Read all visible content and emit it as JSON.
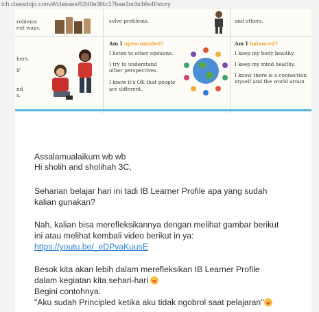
{
  "browser": {
    "url": "ich.classdojo.com/#/classes/62d0e3f4c17bae3ocbcbfe4f/story"
  },
  "poster": {
    "top_left_lines": [
      "roblems",
      "ent ways."
    ],
    "top_mid_line": "solve problems.",
    "top_right_line": "and others.",
    "mid_left_lines": [
      "hers.",
      "lf",
      "",
      "nd",
      "s."
    ],
    "open_minded": {
      "heading_prefix": "Am I ",
      "heading_word": "open-minded?",
      "lines": [
        "I listen to other opinions.",
        "I try to understand",
        "other perspectives.",
        "I know it's OK that people",
        "are different."
      ]
    },
    "balanced": {
      "heading_prefix": "Am I ",
      "heading_word": "balanced?",
      "lines": [
        "I keep my body healthy.",
        "I keep my mind healthy.",
        "I know there is a connection",
        "myself and the world aroun"
      ]
    }
  },
  "post": {
    "greeting": "Assalamualaikum wb wb",
    "salutation": "Hi sholih and sholihah 3C,",
    "p1_l1": "Seharian belajar hari ini tadi IB Learner Profile apa yang sudah",
    "p1_l2": "kalian gunakan?",
    "p2_l1": "Nah, kalian bisa merefleksikannya dengan melihat gambar berikut",
    "p2_l2": "ini atau melihat kembali video berikut in ya:",
    "link": "https://youtu.be/_eDPvaKuusE",
    "p3_l1": "Besok kita akan lebih dalam merefleksikan IB Learner Profile",
    "p3_l2": "dalam kegiatan kita sehari-hari",
    "p3_l3": "Begini contohnya:",
    "p3_l4": "\"Aku sudah Principled ketika aku tidak ngobrol saat pelajaran\""
  }
}
